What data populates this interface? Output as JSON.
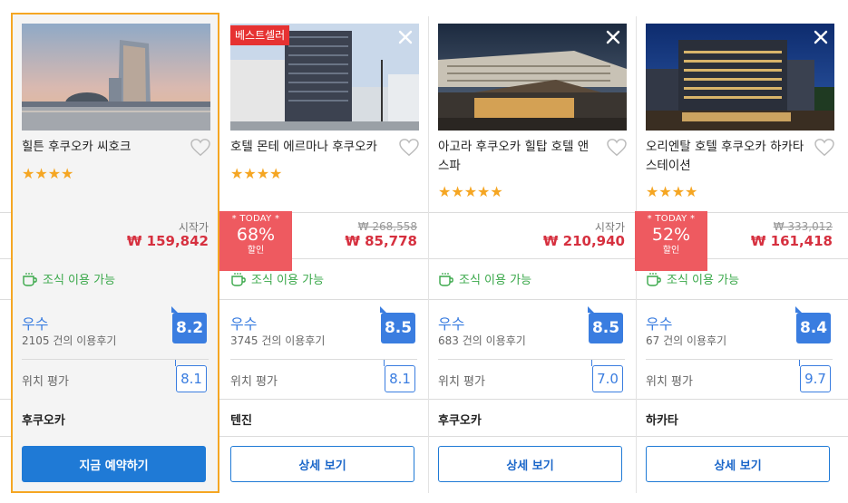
{
  "hotels": [
    {
      "name": "힐튼 후쿠오카 씨호크",
      "stars": "★★★★",
      "badge": "",
      "price_label": "시작가",
      "price": "₩ 159,842",
      "today_label": "",
      "discount": "",
      "discount_unit": "",
      "original_price": "",
      "breakfast": "조식 이용 가능",
      "rating_word": "우수",
      "reviews": "2105 건의 이용후기",
      "score": "8.2",
      "location_label": "위치 평가",
      "location_score": "8.1",
      "city": "후쿠오카",
      "button": "지금 예약하기"
    },
    {
      "name": "호텔 몬테 에르마나 후쿠오카",
      "stars": "★★★★",
      "badge": "베스트셀러",
      "price_label": "",
      "price": "₩ 85,778",
      "today_label": "* TODAY *",
      "discount": "68%",
      "discount_unit": "할인",
      "original_price": "₩ 268,558",
      "breakfast": "조식 이용 가능",
      "rating_word": "우수",
      "reviews": "3745 건의 이용후기",
      "score": "8.5",
      "location_label": "위치 평가",
      "location_score": "8.1",
      "city": "텐진",
      "button": "상세 보기"
    },
    {
      "name": "아고라 후쿠오카 힐탑 호텔 앤 스파",
      "stars": "★★★★★",
      "badge": "",
      "price_label": "시작가",
      "price": "₩ 210,940",
      "today_label": "",
      "discount": "",
      "discount_unit": "",
      "original_price": "",
      "breakfast": "조식 이용 가능",
      "rating_word": "우수",
      "reviews": "683 건의 이용후기",
      "score": "8.5",
      "location_label": "위치 평가",
      "location_score": "7.0",
      "city": "후쿠오카",
      "button": "상세 보기"
    },
    {
      "name": "오리엔탈 호텔 후쿠오카 하카타 스테이션",
      "stars": "★★★★",
      "badge": "",
      "price_label": "",
      "price": "₩ 161,418",
      "today_label": "* TODAY *",
      "discount": "52%",
      "discount_unit": "할인",
      "original_price": "₩ 333,012",
      "breakfast": "조식 이용 가능",
      "rating_word": "우수",
      "reviews": "67 건의 이용후기",
      "score": "8.4",
      "location_label": "위치 평가",
      "location_score": "9.7",
      "city": "하카타",
      "button": "상세 보기"
    }
  ],
  "colors": {
    "selected_border": "#f5a623",
    "price": "#d6303f",
    "rating": "#3a7de0",
    "breakfast": "#3aa84a",
    "primary_button": "#1f7ad6",
    "today_badge": "#ee5a60"
  },
  "icons": [
    "coffee-cup-icon",
    "heart-icon",
    "close-icon",
    "star-icon"
  ]
}
